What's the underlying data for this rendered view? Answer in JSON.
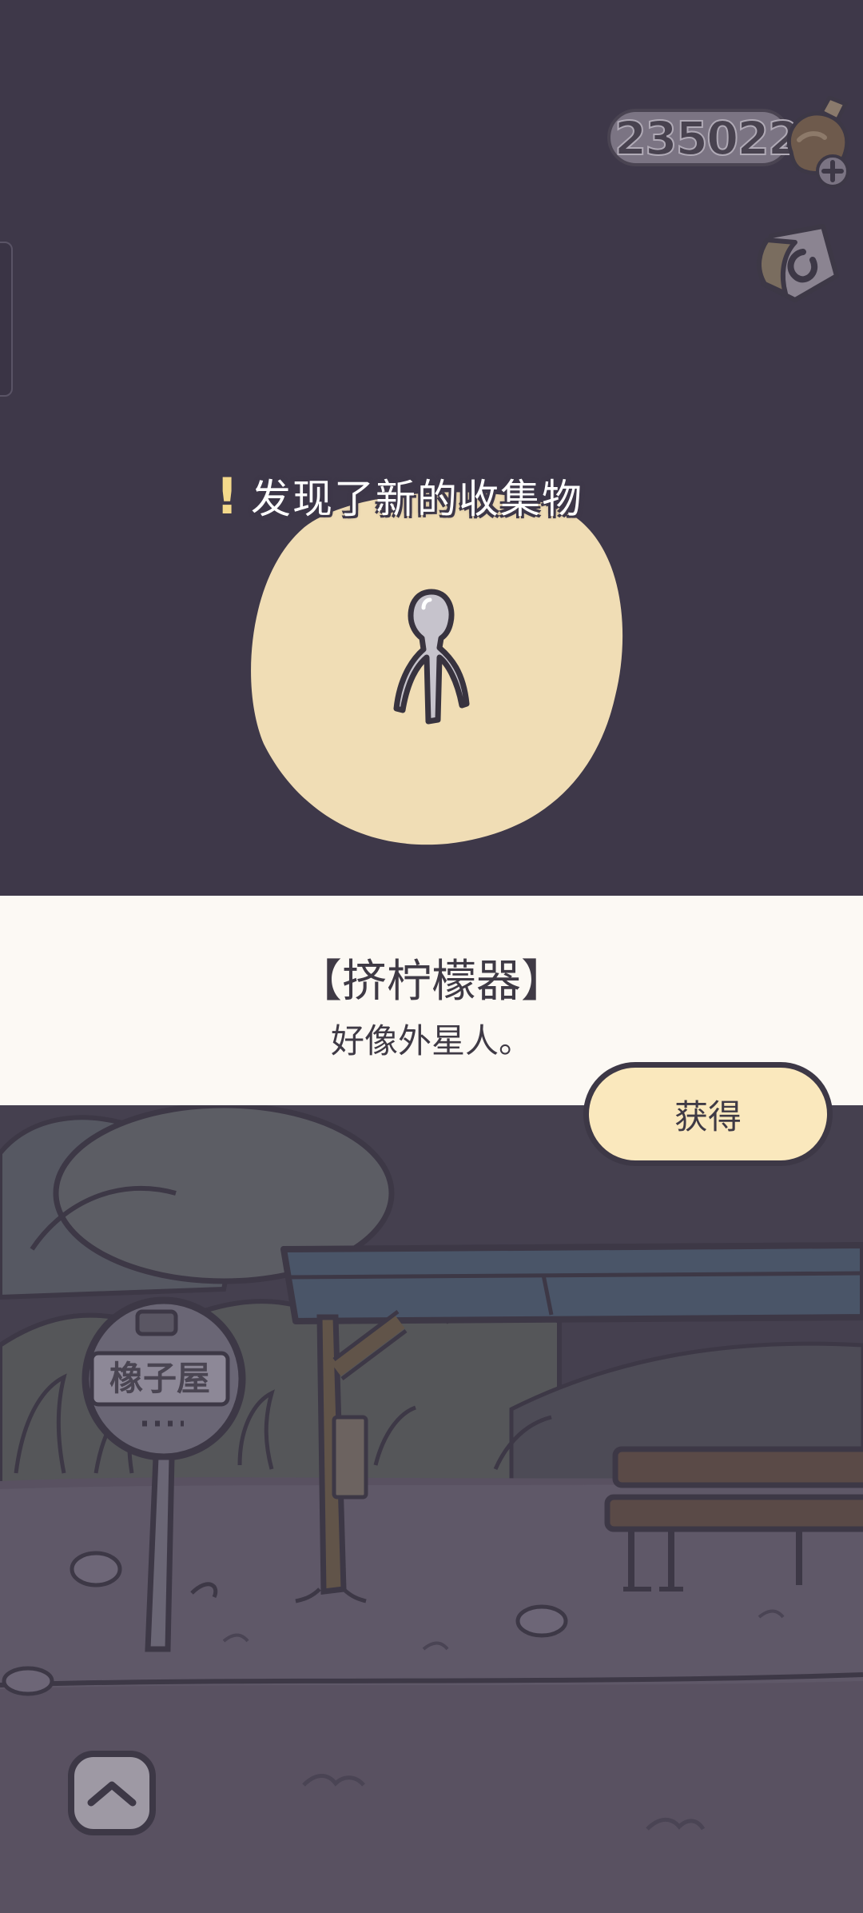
{
  "currency": {
    "value": "235022",
    "icon": "clover-icon",
    "add_icon": "plus-icon"
  },
  "discovery": {
    "title": "发现了新的收集物",
    "icon": "exclamation-icon"
  },
  "item": {
    "name": "【挤柠檬器】",
    "description": "好像外星人。",
    "icon": "lemon-squeezer-icon"
  },
  "buttons": {
    "obtain_label": "获得",
    "home_icon": "chevron-up-icon"
  },
  "scene": {
    "sign_text": "橡子屋",
    "sign_icon": "bus-icon"
  },
  "colors": {
    "background": "#3e3849",
    "accent": "#fae8bd",
    "banner": "#fcf9f4",
    "text": "#3f3a45"
  }
}
